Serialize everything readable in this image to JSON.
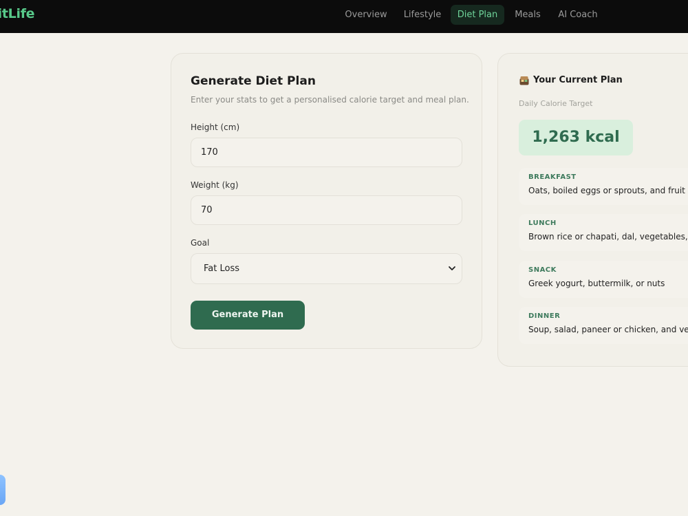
{
  "nav": {
    "brand": "FitLife",
    "links": [
      {
        "label": "Overview"
      },
      {
        "label": "Lifestyle"
      },
      {
        "label": "Diet Plan"
      },
      {
        "label": "Meals"
      },
      {
        "label": "AI Coach"
      }
    ],
    "active": "Diet Plan"
  },
  "form": {
    "title": "Generate Diet Plan",
    "subtitle": "Enter your stats to get a personalised calorie target and meal plan.",
    "height_label": "Height (cm)",
    "height_value": "170",
    "weight_label": "Weight (kg)",
    "weight_value": "70",
    "goal_label": "Goal",
    "goal_value": "Fat Loss",
    "submit_label": "Generate Plan"
  },
  "plan": {
    "icon": "bento-box-icon",
    "title": "Your Current Plan",
    "calorie_label": "Daily Calorie Target",
    "calorie_value": "1,263 kcal",
    "meals": [
      {
        "name": "BREAKFAST",
        "desc": "Oats, boiled eggs or sprouts, and fruit"
      },
      {
        "name": "LUNCH",
        "desc": "Brown rice or chapati, dal, vegetables, an"
      },
      {
        "name": "SNACK",
        "desc": "Greek yogurt, buttermilk, or nuts"
      },
      {
        "name": "DINNER",
        "desc": "Soup, salad, paneer or chicken, and vege"
      }
    ]
  },
  "colors": {
    "nav_bg": "#0c0c0c",
    "brand": "#58c98a",
    "accent": "#2f6b4f",
    "active_tab_bg": "#16291f",
    "active_tab_text": "#6fd49a",
    "calorie_badge_bg": "#d9efdd",
    "page_bg": "#f4f2ec"
  }
}
